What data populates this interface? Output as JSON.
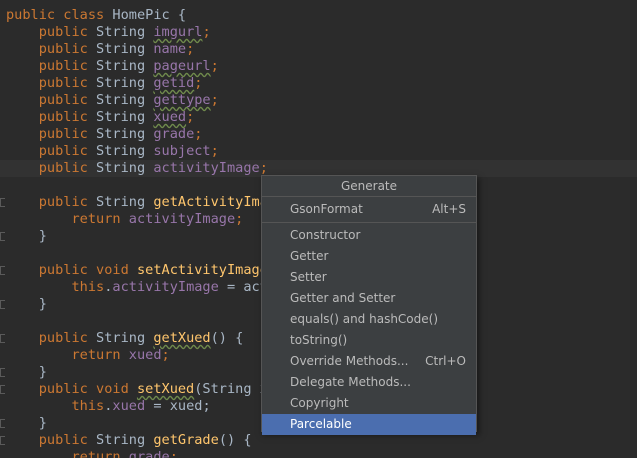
{
  "editor": {
    "lines": [
      [
        {
          "t": "public class ",
          "c": "kw"
        },
        {
          "t": "HomePic {",
          "c": "plain"
        }
      ],
      [
        {
          "t": "    public ",
          "c": "kw"
        },
        {
          "t": "String ",
          "c": "plain"
        },
        {
          "t": "imgurl",
          "c": "fld typo"
        },
        {
          "t": ";",
          "c": "kw"
        }
      ],
      [
        {
          "t": "    public ",
          "c": "kw"
        },
        {
          "t": "String ",
          "c": "plain"
        },
        {
          "t": "name",
          "c": "fld"
        },
        {
          "t": ";",
          "c": "kw"
        }
      ],
      [
        {
          "t": "    public ",
          "c": "kw"
        },
        {
          "t": "String ",
          "c": "plain"
        },
        {
          "t": "pageurl",
          "c": "fld typo"
        },
        {
          "t": ";",
          "c": "kw"
        }
      ],
      [
        {
          "t": "    public ",
          "c": "kw"
        },
        {
          "t": "String ",
          "c": "plain"
        },
        {
          "t": "getid",
          "c": "fld typo"
        },
        {
          "t": ";",
          "c": "kw"
        }
      ],
      [
        {
          "t": "    public ",
          "c": "kw"
        },
        {
          "t": "String ",
          "c": "plain"
        },
        {
          "t": "gettype",
          "c": "fld typo"
        },
        {
          "t": ";",
          "c": "kw"
        }
      ],
      [
        {
          "t": "    public ",
          "c": "kw"
        },
        {
          "t": "String ",
          "c": "plain"
        },
        {
          "t": "xued",
          "c": "fld typo"
        },
        {
          "t": ";",
          "c": "kw"
        }
      ],
      [
        {
          "t": "    public ",
          "c": "kw"
        },
        {
          "t": "String ",
          "c": "plain"
        },
        {
          "t": "grade",
          "c": "fld"
        },
        {
          "t": ";",
          "c": "kw"
        }
      ],
      [
        {
          "t": "    public ",
          "c": "kw"
        },
        {
          "t": "String ",
          "c": "plain"
        },
        {
          "t": "subject",
          "c": "fld"
        },
        {
          "t": ";",
          "c": "kw"
        }
      ],
      [
        {
          "t": "    public ",
          "c": "kw"
        },
        {
          "t": "String ",
          "c": "plain"
        },
        {
          "t": "activityImage",
          "c": "fld"
        },
        {
          "t": ";",
          "c": "kw"
        }
      ],
      [],
      [
        {
          "t": "    public ",
          "c": "kw"
        },
        {
          "t": "String ",
          "c": "plain"
        },
        {
          "t": "getActivityIma",
          "c": "fn"
        }
      ],
      [
        {
          "t": "        return ",
          "c": "kw"
        },
        {
          "t": "activityImage",
          "c": "fld"
        },
        {
          "t": ";",
          "c": "kw"
        }
      ],
      [
        {
          "t": "    }",
          "c": "plain"
        }
      ],
      [],
      [
        {
          "t": "    public void ",
          "c": "kw"
        },
        {
          "t": "setActivityImage",
          "c": "fn"
        }
      ],
      [
        {
          "t": "        this",
          "c": "kw"
        },
        {
          "t": ".",
          "c": "plain"
        },
        {
          "t": "activityImage",
          "c": "fld"
        },
        {
          "t": " = act",
          "c": "plain"
        }
      ],
      [
        {
          "t": "    }",
          "c": "plain"
        }
      ],
      [],
      [
        {
          "t": "    public ",
          "c": "kw"
        },
        {
          "t": "String ",
          "c": "plain"
        },
        {
          "t": "getXued",
          "c": "fn typo"
        },
        {
          "t": "() {",
          "c": "plain"
        }
      ],
      [
        {
          "t": "        return ",
          "c": "kw"
        },
        {
          "t": "xued",
          "c": "fld"
        },
        {
          "t": ";",
          "c": "kw"
        }
      ],
      [
        {
          "t": "    }",
          "c": "plain"
        }
      ],
      [
        {
          "t": "    public void ",
          "c": "kw"
        },
        {
          "t": "setXued",
          "c": "fn typo"
        },
        {
          "t": "(String x",
          "c": "plain"
        }
      ],
      [
        {
          "t": "        this",
          "c": "kw"
        },
        {
          "t": ".",
          "c": "plain"
        },
        {
          "t": "xued",
          "c": "fld"
        },
        {
          "t": " = xued;",
          "c": "plain"
        }
      ],
      [
        {
          "t": "    }",
          "c": "plain"
        }
      ],
      [
        {
          "t": "    public ",
          "c": "kw"
        },
        {
          "t": "String ",
          "c": "plain"
        },
        {
          "t": "getGrade",
          "c": "fn"
        },
        {
          "t": "() {",
          "c": "plain"
        }
      ],
      [
        {
          "t": "        return ",
          "c": "kw"
        },
        {
          "t": "grade",
          "c": "fld"
        },
        {
          "t": ";",
          "c": "kw"
        }
      ]
    ],
    "current_line_index": 9,
    "colors": {
      "background": "#2b2b2b",
      "keyword": "#cc7832",
      "field": "#9876aa",
      "method": "#ffc66d",
      "text": "#a9b7c6",
      "selection": "#4b6eaf"
    }
  },
  "popup": {
    "title": "Generate",
    "top_items": [
      {
        "label": "GsonFormat",
        "shortcut": "Alt+S"
      }
    ],
    "items": [
      {
        "label": "Constructor",
        "shortcut": ""
      },
      {
        "label": "Getter",
        "shortcut": ""
      },
      {
        "label": "Setter",
        "shortcut": ""
      },
      {
        "label": "Getter and Setter",
        "shortcut": ""
      },
      {
        "label": "equals() and hashCode()",
        "shortcut": ""
      },
      {
        "label": "toString()",
        "shortcut": ""
      },
      {
        "label": "Override Methods...",
        "shortcut": "Ctrl+O"
      },
      {
        "label": "Delegate Methods...",
        "shortcut": ""
      },
      {
        "label": "Copyright",
        "shortcut": ""
      },
      {
        "label": "Parcelable",
        "shortcut": "",
        "selected": true
      }
    ]
  }
}
